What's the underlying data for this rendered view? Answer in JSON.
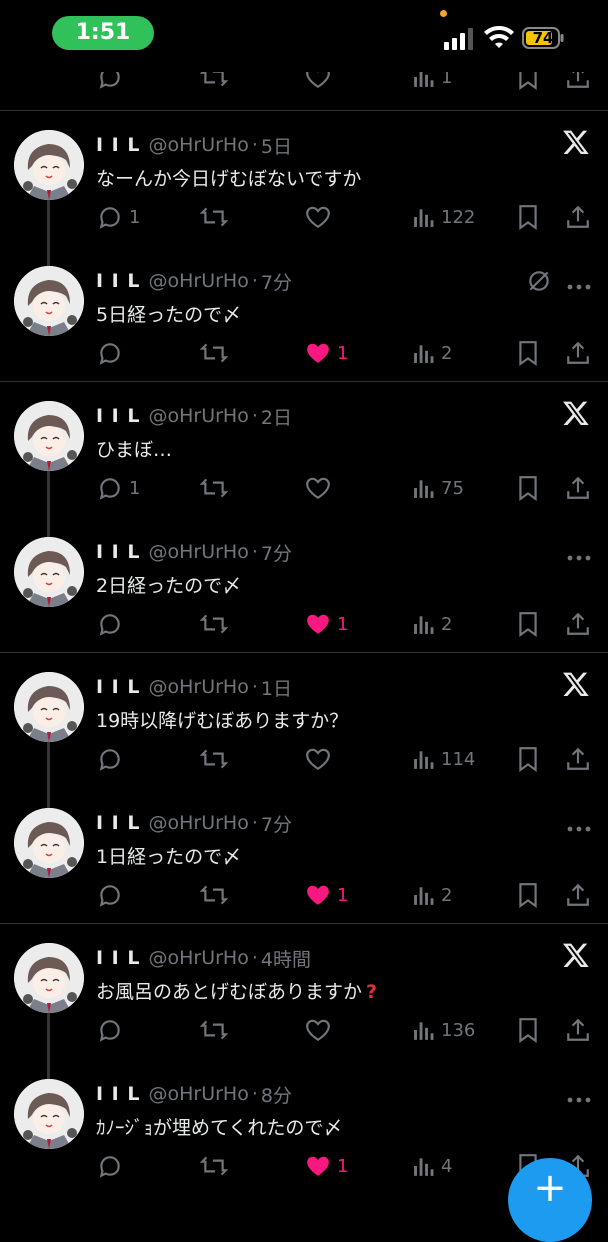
{
  "status_bar": {
    "time": "1:51",
    "battery": "74"
  },
  "tweets": [
    {
      "name": "I I L",
      "handle": "@oHrUrHo",
      "time": "5日",
      "text": "なーんか今日げむぼないですか",
      "reply": "1",
      "retweet": "",
      "like": "",
      "views": "122"
    },
    {
      "name": "I I L",
      "handle": "@oHrUrHo",
      "time": "7分",
      "text": "5日経ったので〆",
      "reply": "",
      "retweet": "",
      "like": "1",
      "views": "2"
    },
    {
      "name": "I I L",
      "handle": "@oHrUrHo",
      "time": "2日",
      "text": "ひまぼ…",
      "reply": "1",
      "retweet": "",
      "like": "",
      "views": "75"
    },
    {
      "name": "I I L",
      "handle": "@oHrUrHo",
      "time": "7分",
      "text": "2日経ったので〆",
      "reply": "",
      "retweet": "",
      "like": "1",
      "views": "2"
    },
    {
      "name": "I I L",
      "handle": "@oHrUrHo",
      "time": "1日",
      "text": "19時以降げむぼありますか？",
      "reply": "",
      "retweet": "",
      "like": "",
      "views": "114"
    },
    {
      "name": "I I L",
      "handle": "@oHrUrHo",
      "time": "7分",
      "text": "1日経ったので〆",
      "reply": "",
      "retweet": "",
      "like": "1",
      "views": "2"
    },
    {
      "name": "I I L",
      "handle": "@oHrUrHo",
      "time": "4時間",
      "text": "お風呂のあとげむぼありますか",
      "reply": "",
      "retweet": "",
      "like": "",
      "views": "136"
    },
    {
      "name": "I I L",
      "handle": "@oHrUrHo",
      "time": "8分",
      "text": "ｶﾉｰｼﾞｮが埋めてくれたので〆",
      "reply": "",
      "retweet": "",
      "like": "1",
      "views": "4"
    }
  ],
  "top_cutoff": {
    "views": "1"
  },
  "icons": {
    "reply": "reply-icon",
    "retweet": "retweet-icon",
    "like": "heart-icon",
    "views": "views-icon",
    "bookmark": "bookmark-icon",
    "share": "share-icon",
    "x_logo": "x-logo-icon",
    "more": "more-icon",
    "hide": "hidden-icon",
    "fab": "compose-icon"
  },
  "colors": {
    "background": "#000000",
    "text": "#e7e9ea",
    "muted": "#71767b",
    "like": "#f91880",
    "accent": "#1d9bf0",
    "time_pill": "#30c15a"
  },
  "fab_label": "+"
}
